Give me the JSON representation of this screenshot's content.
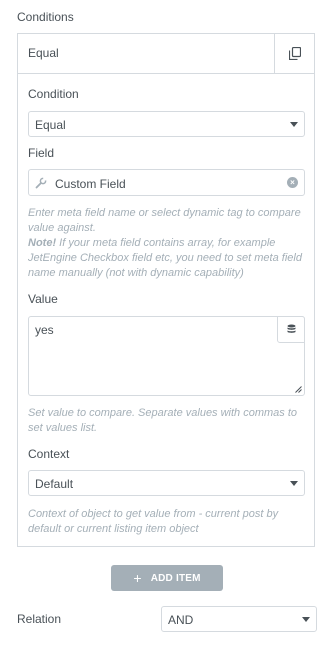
{
  "section": {
    "title": "Conditions"
  },
  "item": {
    "title": "Equal",
    "duplicate_icon": "duplicate-icon",
    "condition": {
      "label": "Condition",
      "value": "Equal"
    },
    "field": {
      "label": "Field",
      "value": "Custom Field",
      "prefix_icon": "wrench-icon",
      "clear_icon": "clear-icon",
      "description_line1": "Enter meta field name or select dynamic tag to compare value against.",
      "note_label": "Note!",
      "note_text": " If your meta field contains array, for example JetEngine Checkbox field etc, you need to set meta field name manually (not with dynamic capability)"
    },
    "value": {
      "label": "Value",
      "value": "yes",
      "dynamic_icon": "database-icon",
      "description": "Set value to compare. Separate values with commas to set values list."
    },
    "context": {
      "label": "Context",
      "value": "Default",
      "description": "Context of object to get value from - current post by default or current listing item object"
    }
  },
  "add_button": {
    "icon": "+",
    "label": "ADD ITEM"
  },
  "relation": {
    "label": "Relation",
    "value": "AND"
  },
  "colors": {
    "text": "#495157",
    "muted": "#a4afb7",
    "border": "#d5dadf",
    "button": "#a4afb7"
  }
}
